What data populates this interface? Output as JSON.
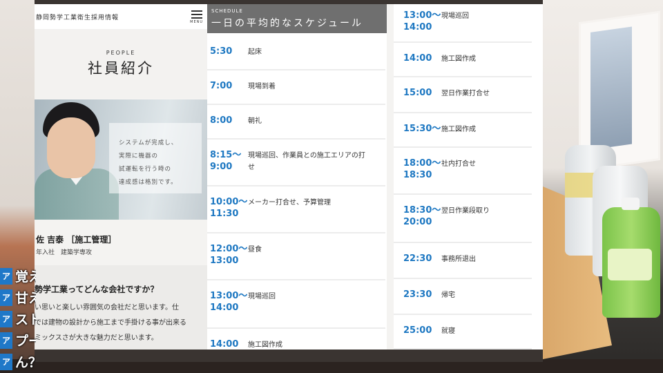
{
  "site": {
    "title": "静岡勢学工業衛生採用情報",
    "menu_label": "MENU"
  },
  "people": {
    "label": "PEOPLE",
    "title": "社員紹介",
    "quote_lines": [
      "システムが完成し、",
      "実際に機器の",
      "試運転を行う時の",
      "達成感は格別です。"
    ],
    "name": "佐 吉泰 ［施工管理］",
    "dept": "年入社　建築学専攻",
    "question": "勢学工業ってどんな会社ですか？",
    "answer_lines": [
      "い思いと楽しい雰囲気の会社だと思います。仕",
      "では建物の設計から施工まで手掛ける事が出来る",
      "ミックスさが大きな魅力だと思います。"
    ]
  },
  "schedule": {
    "label_en": "SCHEDULE",
    "title": "一日の平均的なスケジュール",
    "left_items": [
      {
        "time": "5:30",
        "activity": "起床"
      },
      {
        "time": "7:00",
        "activity": "現場到着"
      },
      {
        "time": "8:00",
        "activity": "朝礼"
      },
      {
        "time": "8:15～\n9:00",
        "activity": "現場巡回、作業員との施工エリアの打",
        "activity2": "せ"
      },
      {
        "time": "10:00～\n11:30",
        "activity": "メーカー打合せ、予算管理"
      },
      {
        "time": "12:00～\n13:00",
        "activity": "昼食"
      },
      {
        "time": "13:00～\n14:00",
        "activity": "現場巡回"
      },
      {
        "time": "14:00",
        "activity": "施工図作成"
      }
    ],
    "right_items": [
      {
        "time": "13:00～\n14:00",
        "activity": "現場巡回"
      },
      {
        "time": "14:00",
        "activity": "施工図作成"
      },
      {
        "time": "15:00",
        "activity": "翌日作業打合せ"
      },
      {
        "time": "15:30～",
        "activity": "施工図作成"
      },
      {
        "time": "18:00～\n18:30",
        "activity": "社内打合せ"
      },
      {
        "time": "18:30～\n20:00",
        "activity": "翌日作業段取り"
      },
      {
        "time": "22:30",
        "activity": "事務所退出"
      },
      {
        "time": "23:30",
        "activity": "帰宅"
      },
      {
        "time": "25:00",
        "activity": "就寝"
      }
    ]
  },
  "chat": {
    "badge": "ア",
    "messages": [
      "覚え",
      "甘え",
      "スト",
      "プー",
      "ん？"
    ]
  }
}
